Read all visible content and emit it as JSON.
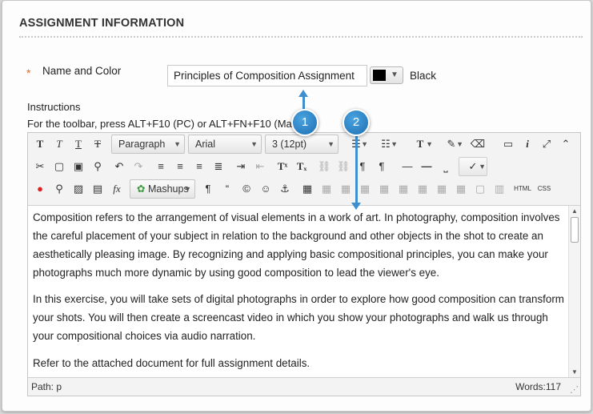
{
  "section": {
    "title": "ASSIGNMENT INFORMATION"
  },
  "name_field": {
    "required_mark": "*",
    "label": "Name and Color",
    "value": "Principles of Composition Assignment",
    "color_name": "Black",
    "color_value": "#000000"
  },
  "instructions": {
    "label": "Instructions",
    "hint": "For the toolbar, press ALT+F10 (PC) or ALT+FN+F10 (Mac)."
  },
  "toolbar": {
    "row1": {
      "paragraph_format": "Paragraph",
      "font_family": "Arial",
      "font_size": "3 (12pt)"
    },
    "row3": {
      "mashups": "Mashups",
      "html": "HTML",
      "css": "CSS"
    }
  },
  "content": {
    "paragraphs": [
      "Composition refers to the arrangement of visual elements in a work of art.  In photography, composition involves the careful placement of your subject in relation to the background and other objects in the shot to create an aesthetically pleasing image.  By recognizing and applying basic compositional principles, you can make your photographs much more dynamic by using good composition to lead the viewer's eye.",
      "In this exercise, you will take sets of digital photographs in order to explore how good composition can transform your shots.  You will then create a screencast video in which you show your photographs and walk us through your compositional choices via audio narration.",
      "Refer to the attached document for full assignment details."
    ]
  },
  "status": {
    "path": "Path: p",
    "words": "Words:117"
  },
  "callouts": {
    "one": "1",
    "two": "2"
  },
  "colors": {
    "accent": "#2f86c9",
    "required": "#e06b2a"
  }
}
